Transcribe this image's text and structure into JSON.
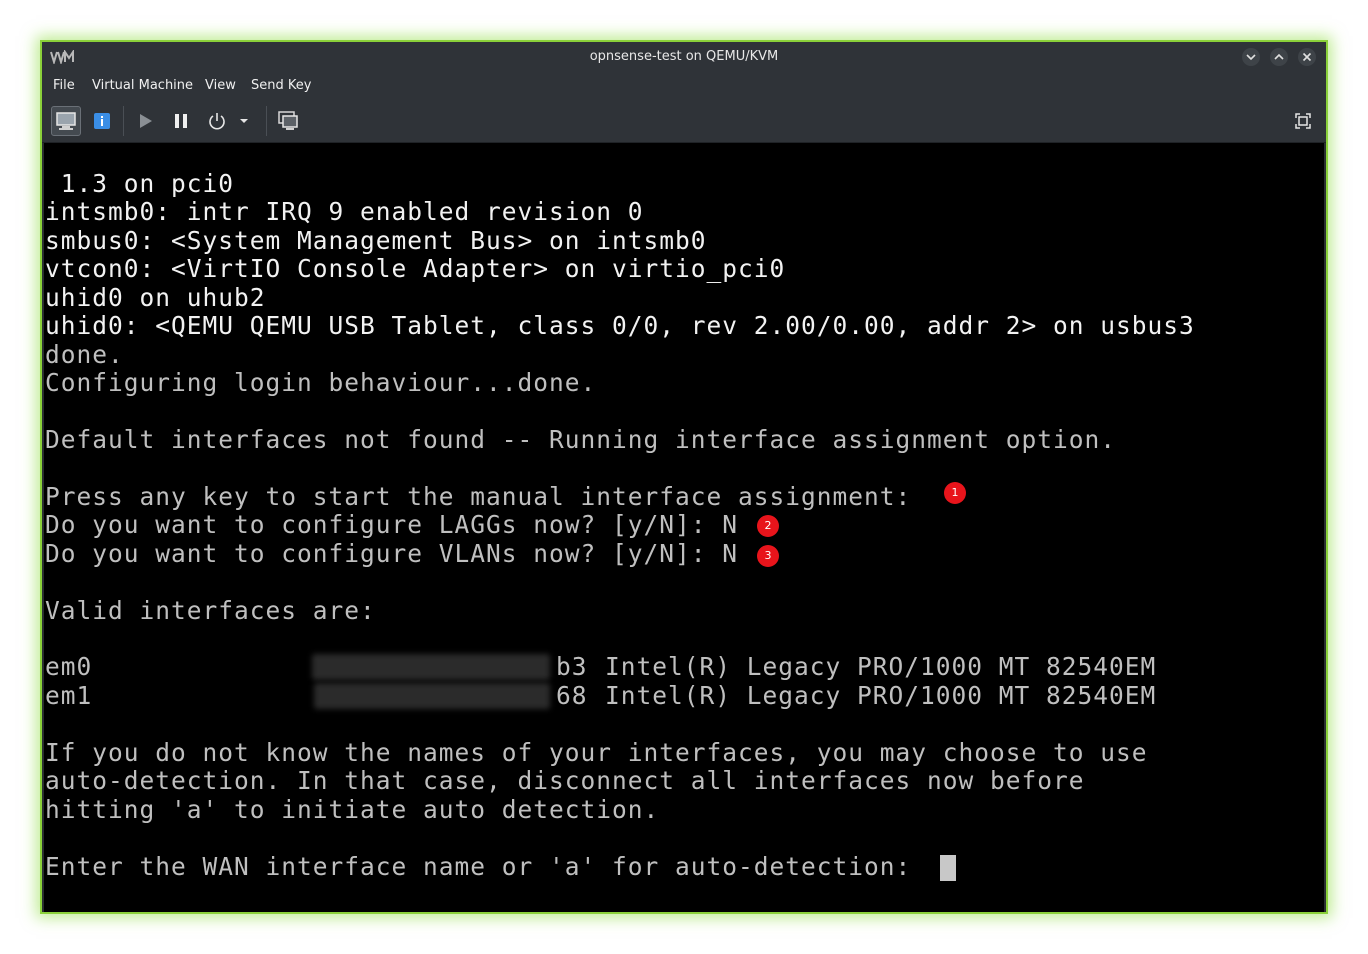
{
  "window": {
    "title": "opnsense-test on QEMU/KVM",
    "controls": [
      "minimize",
      "maximize",
      "close"
    ]
  },
  "menu": {
    "file": "File",
    "virtual_machine": "Virtual Machine",
    "view": "View",
    "send_key": "Send Key"
  },
  "toolbar": {
    "icons": [
      "console-icon",
      "details-icon",
      "run-icon",
      "pause-icon",
      "shutdown-icon",
      "shutdown-dropdown-icon",
      "snapshots-icon",
      "fullscreen-icon"
    ]
  },
  "console": {
    "lines": [
      " 1.3 on pci0",
      "intsmb0: intr IRQ 9 enabled revision 0",
      "smbus0: <System Management Bus> on intsmb0",
      "vtcon0: <VirtIO Console Adapter> on virtio_pci0",
      "uhid0 on uhub2",
      "uhid0: <QEMU QEMU USB Tablet, class 0/0, rev 2.00/0.00, addr 2> on usbus3",
      "done.",
      "Configuring login behaviour...done.",
      "",
      "Default interfaces not found -- Running interface assignment option.",
      "",
      "Press any key to start the manual interface assignment:",
      "Do you want to configure LAGGs now? [y/N]: N",
      "Do you want to configure VLANs now? [y/N]: N",
      "",
      "Valid interfaces are:",
      "",
      "em0",
      "em1",
      "",
      "If you do not know the names of your interfaces, you may choose to use",
      "auto-detection. In that case, disconnect all interfaces now before",
      "hitting 'a' to initiate auto detection.",
      "",
      "Enter the WAN interface name or 'a' for auto-detection:"
    ],
    "interfaces": [
      {
        "name": "em0",
        "mac_suffix": "b3",
        "description": "Intel(R) Legacy PRO/1000 MT 82540EM"
      },
      {
        "name": "em1",
        "mac_suffix": "68",
        "description": "Intel(R) Legacy PRO/1000 MT 82540EM"
      }
    ]
  },
  "annotations": [
    "1",
    "2",
    "3"
  ],
  "colors": {
    "window_border": "#8bd13a",
    "chrome_bg": "#2f3338",
    "console_bg": "#000000",
    "console_text": "#f2f2f2",
    "badge": "#e8141b"
  }
}
